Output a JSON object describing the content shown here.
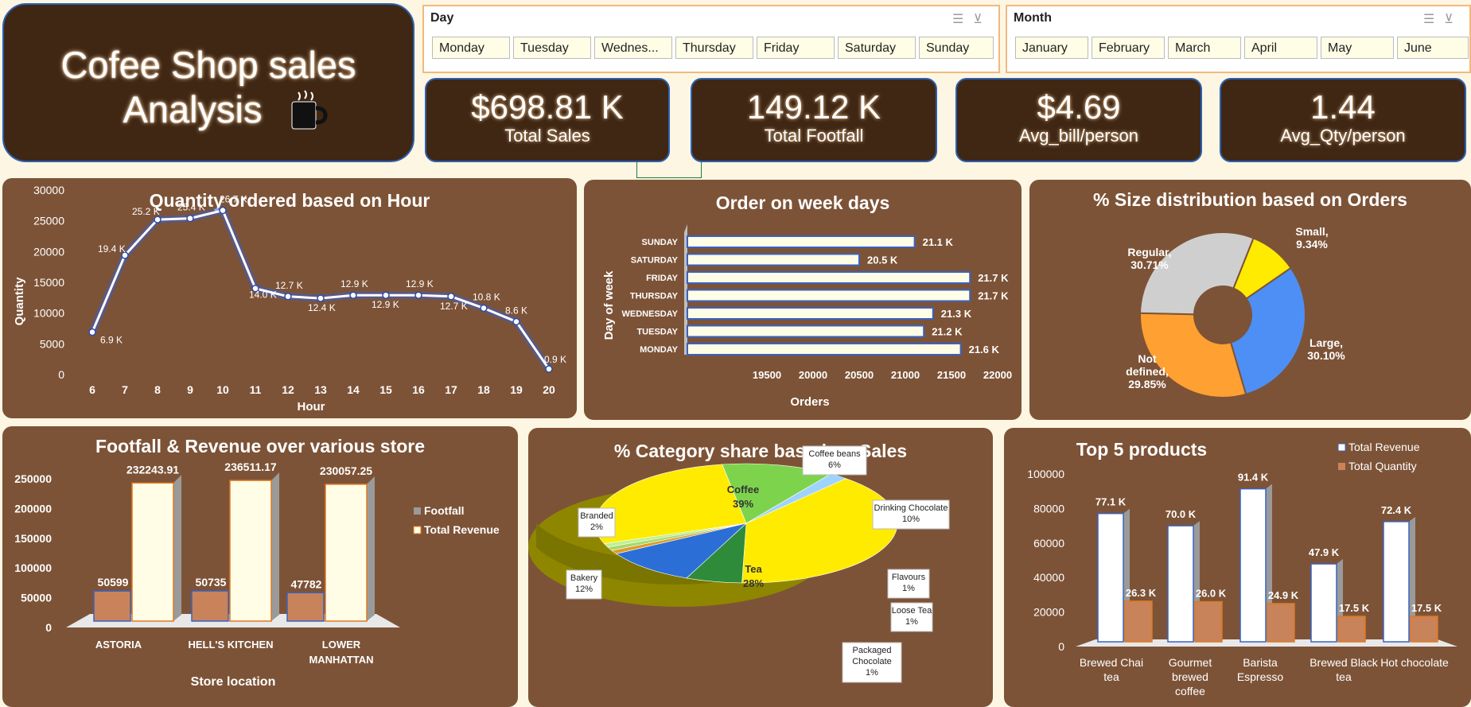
{
  "title": {
    "line1": "Cofee Shop sales",
    "line2": "Analysis"
  },
  "colors": {
    "panel": "#7d5337",
    "dark": "#3f2714",
    "cream": "#fffde6",
    "orange": "#c9835a"
  },
  "slicers": {
    "day": {
      "label": "Day",
      "items": [
        "Monday",
        "Tuesday",
        "Wednes...",
        "Thursday",
        "Friday",
        "Saturday",
        "Sunday"
      ]
    },
    "month": {
      "label": "Month",
      "items": [
        "January",
        "February",
        "March",
        "April",
        "May",
        "June"
      ]
    }
  },
  "kpis": [
    {
      "value": "$698.81 K",
      "label": "Total Sales"
    },
    {
      "value": "149.12 K",
      "label": "Total Footfall"
    },
    {
      "value": "$4.69",
      "label": "Avg_bill/person"
    },
    {
      "value": "1.44",
      "label": "Avg_Qty/person"
    }
  ],
  "charts": {
    "hour": {
      "title": "Quantity ordered based on Hour",
      "xlabel": "Hour",
      "ylabel": "Quantity",
      "yticks": [
        "0",
        "5000",
        "10000",
        "15000",
        "20000",
        "25000",
        "30000"
      ],
      "x": [
        "6",
        "7",
        "8",
        "9",
        "10",
        "11",
        "12",
        "13",
        "14",
        "15",
        "16",
        "17",
        "18",
        "19",
        "20"
      ],
      "labels": [
        "6.9 K",
        "19.4 K",
        "25.2 K",
        "25.4 K",
        "26.7 K",
        "14.0 K",
        "12.7 K",
        "12.4 K",
        "12.9 K",
        "12.9 K",
        "12.9 K",
        "12.7 K",
        "10.8 K",
        "8.6 K",
        "0.9 K"
      ]
    },
    "weekday": {
      "title": "Order on week days",
      "xlabel": "Orders",
      "ylabel": "Day of week",
      "xticks": [
        "19500",
        "20000",
        "20500",
        "21000",
        "21500",
        "22000"
      ],
      "days": [
        "SUNDAY",
        "SATURDAY",
        "FRIDAY",
        "THURSDAY",
        "WEDNESDAY",
        "TUESDAY",
        "MONDAY"
      ],
      "labels": [
        "21.1 K",
        "20.5 K",
        "21.7 K",
        "21.7 K",
        "21.3 K",
        "21.2 K",
        "21.6 K"
      ]
    },
    "size": {
      "title": "% Size distribution based on Orders",
      "slices": [
        {
          "name": "Small,",
          "pct": "9.34%",
          "color": "#ffeb00"
        },
        {
          "name": "Large,",
          "pct": "30.10%",
          "color": "#4d8ff5"
        },
        {
          "name": "Not defined,",
          "pct": "29.85%",
          "color": "#ffa032"
        },
        {
          "name": "Regular,",
          "pct": "30.71%",
          "color": "#cfcfcf"
        }
      ]
    },
    "store": {
      "title": "Footfall & Revenue over various store",
      "xlabel": "Store location",
      "yticks": [
        "0",
        "50000",
        "100000",
        "150000",
        "200000",
        "250000"
      ],
      "legend": [
        "Footfall",
        "Total Revenue"
      ],
      "stores": [
        {
          "name": "ASTORIA",
          "footfall": "50599",
          "revenue": "232243.91"
        },
        {
          "name": "HELL'S KITCHEN",
          "footfall": "50735",
          "revenue": "236511.17"
        },
        {
          "name": "LOWER MANHATTAN",
          "footfall": "47782",
          "revenue": "230057.25"
        }
      ]
    },
    "category": {
      "title": "% Category share based on Sales",
      "slices": [
        {
          "name": "Coffee",
          "pct": "39%",
          "color": "#ffeb00"
        },
        {
          "name": "Coffee beans",
          "pct": "6%",
          "color": "#2e8b3a"
        },
        {
          "name": "Drinking Chocolate",
          "pct": "10%",
          "color": "#2b6fd6"
        },
        {
          "name": "Flavours",
          "pct": "1%",
          "color": "#e09a2a"
        },
        {
          "name": "Loose Tea",
          "pct": "1%",
          "color": "#a6d96a"
        },
        {
          "name": "Packaged Chocolate",
          "pct": "1%",
          "color": "#c0f090"
        },
        {
          "name": "Tea",
          "pct": "28%",
          "color": "#ffeb00"
        },
        {
          "name": "Bakery",
          "pct": "12%",
          "color": "#7ed34d"
        },
        {
          "name": "Branded",
          "pct": "2%",
          "color": "#9fd3ff"
        }
      ]
    },
    "products": {
      "title": "Top 5 products",
      "legend": [
        "Total Revenue",
        "Total Quantity"
      ],
      "yticks": [
        "0",
        "20000",
        "40000",
        "60000",
        "80000",
        "100000"
      ],
      "products": [
        {
          "name": "Brewed Chai tea",
          "revenue": "77.1 K",
          "quantity": "26.3 K"
        },
        {
          "name": "Gourmet brewed coffee",
          "revenue": "70.0 K",
          "quantity": "26.0 K"
        },
        {
          "name": "Barista Espresso",
          "revenue": "91.4 K",
          "quantity": "24.9 K"
        },
        {
          "name": "Brewed Black tea",
          "revenue": "47.9 K",
          "quantity": "17.5 K"
        },
        {
          "name": "Hot chocolate",
          "revenue": "72.4 K",
          "quantity": "17.5 K"
        }
      ]
    }
  },
  "chart_data": [
    {
      "type": "line",
      "title": "Quantity ordered based on Hour",
      "xlabel": "Hour",
      "ylabel": "Quantity",
      "x": [
        6,
        7,
        8,
        9,
        10,
        11,
        12,
        13,
        14,
        15,
        16,
        17,
        18,
        19,
        20
      ],
      "values": [
        6900,
        19400,
        25200,
        25400,
        26700,
        14000,
        12700,
        12400,
        12900,
        12900,
        12900,
        12700,
        10800,
        8600,
        900
      ],
      "ylim": [
        0,
        30000
      ]
    },
    {
      "type": "bar",
      "title": "Order on week days",
      "xlabel": "Orders",
      "ylabel": "Day of week",
      "categories": [
        "SUNDAY",
        "SATURDAY",
        "FRIDAY",
        "THURSDAY",
        "WEDNESDAY",
        "TUESDAY",
        "MONDAY"
      ],
      "values": [
        21100,
        20500,
        21700,
        21700,
        21300,
        21200,
        21600
      ],
      "xlim": [
        19500,
        22000
      ]
    },
    {
      "type": "pie",
      "title": "% Size distribution based on Orders",
      "categories": [
        "Small",
        "Large",
        "Not defined",
        "Regular"
      ],
      "values": [
        9.34,
        30.1,
        29.85,
        30.71
      ]
    },
    {
      "type": "bar",
      "title": "Footfall & Revenue over various store",
      "xlabel": "Store location",
      "categories": [
        "ASTORIA",
        "HELL'S KITCHEN",
        "LOWER MANHATTAN"
      ],
      "series": [
        {
          "name": "Footfall",
          "values": [
            50599,
            50735,
            47782
          ]
        },
        {
          "name": "Total Revenue",
          "values": [
            232243.91,
            236511.17,
            230057.25
          ]
        }
      ],
      "ylim": [
        0,
        250000
      ]
    },
    {
      "type": "pie",
      "title": "% Category share based on Sales",
      "categories": [
        "Coffee",
        "Coffee beans",
        "Drinking Chocolate",
        "Flavours",
        "Loose Tea",
        "Packaged Chocolate",
        "Tea",
        "Bakery",
        "Branded"
      ],
      "values": [
        39,
        6,
        10,
        1,
        1,
        1,
        28,
        12,
        2
      ]
    },
    {
      "type": "bar",
      "title": "Top 5 products",
      "categories": [
        "Brewed Chai tea",
        "Gourmet brewed coffee",
        "Barista Espresso",
        "Brewed Black tea",
        "Hot chocolate"
      ],
      "series": [
        {
          "name": "Total Revenue",
          "values": [
            77100,
            70000,
            91400,
            47900,
            72400
          ]
        },
        {
          "name": "Total Quantity",
          "values": [
            26300,
            26000,
            24900,
            17500,
            17500
          ]
        }
      ],
      "ylim": [
        0,
        100000
      ]
    }
  ]
}
